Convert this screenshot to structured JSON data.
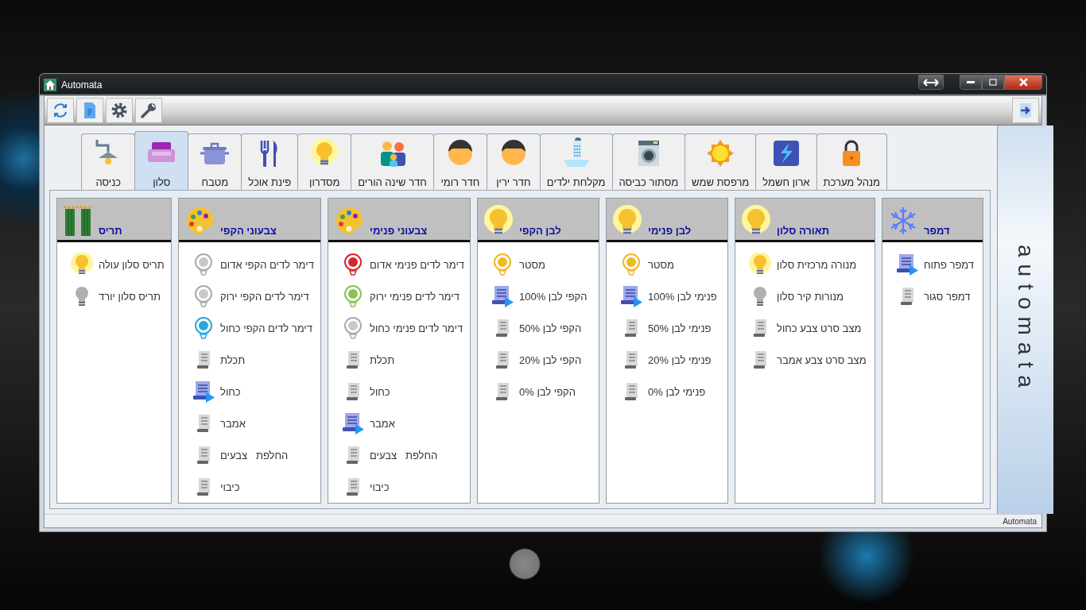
{
  "window": {
    "title": "Automata"
  },
  "tabs": [
    {
      "label": "מנהל מערכת",
      "kind": "lock",
      "selected": false
    },
    {
      "label": "ארון חשמל",
      "kind": "lightning",
      "selected": false
    },
    {
      "label": "מרפסת שמש",
      "kind": "sun",
      "selected": false
    },
    {
      "label": "מסתור כביסה",
      "kind": "washer",
      "selected": false
    },
    {
      "label": "מקלחת ילדים",
      "kind": "shower",
      "selected": false
    },
    {
      "label": "חדר ירין",
      "kind": "person",
      "selected": false
    },
    {
      "label": "חדר רומי",
      "kind": "person",
      "selected": false
    },
    {
      "label": "חדר שינה הורים",
      "kind": "family",
      "selected": false
    },
    {
      "label": "מסדרון",
      "kind": "bulb",
      "selected": false
    },
    {
      "label": "פינת אוכל",
      "kind": "cutlery",
      "selected": false
    },
    {
      "label": "מטבח",
      "kind": "pot",
      "selected": false
    },
    {
      "label": "סלון",
      "kind": "sofa",
      "selected": true
    },
    {
      "label": "כניסה",
      "kind": "lamp",
      "selected": false
    }
  ],
  "panels": [
    {
      "title": "דמפר",
      "kind": "snowflake",
      "items": [
        {
          "label": "דמפר פתוח",
          "kind": "scene",
          "on": true
        },
        {
          "label": "דמפר סגור",
          "kind": "scene",
          "on": false
        }
      ]
    },
    {
      "title": "תאורה סלון",
      "kind": "bulb",
      "items": [
        {
          "label": "מנורה מרכזית סלון",
          "kind": "lamp",
          "on": true
        },
        {
          "label": "מנורות קיר סלון",
          "kind": "lamp",
          "on": false
        },
        {
          "label": "מצב סרט צבע כחול",
          "kind": "scene",
          "on": false
        },
        {
          "label": "מצב סרט צבע אמבר",
          "kind": "scene",
          "on": false
        }
      ]
    },
    {
      "title": "לבן פנימי",
      "kind": "bulb",
      "items": [
        {
          "label": "מסטר",
          "kind": "led",
          "on": true,
          "color": "#f2b824"
        },
        {
          "label": "פנימי לבן 100%",
          "kind": "scene",
          "on": true
        },
        {
          "label": "פנימי לבן 50%",
          "kind": "scene",
          "on": false
        },
        {
          "label": "פנימי לבן 20%",
          "kind": "scene",
          "on": false
        },
        {
          "label": "פנימי לבן 0%",
          "kind": "scene",
          "on": false
        }
      ]
    },
    {
      "title": "לבן הקפי",
      "kind": "bulb",
      "items": [
        {
          "label": "מסטר",
          "kind": "led",
          "on": true,
          "color": "#f2b824"
        },
        {
          "label": "הקפי לבן 100%",
          "kind": "scene",
          "on": true
        },
        {
          "label": "הקפי לבן 50%",
          "kind": "scene",
          "on": false
        },
        {
          "label": "הקפי לבן 20%",
          "kind": "scene",
          "on": false
        },
        {
          "label": "הקפי לבן 0%",
          "kind": "scene",
          "on": false
        }
      ]
    },
    {
      "title": "צבעוני פנימי",
      "kind": "palette",
      "items": [
        {
          "label": "דימר לדים פנימי אדום",
          "kind": "led",
          "on": true,
          "color": "#d7262b"
        },
        {
          "label": "דימר לדים פנימי ירוק",
          "kind": "led",
          "on": true,
          "color": "#8cc350"
        },
        {
          "label": "דימר לדים פנימי כחול",
          "kind": "led",
          "on": false
        },
        {
          "label": "תכלת",
          "kind": "scene",
          "on": false
        },
        {
          "label": "כחול",
          "kind": "scene",
          "on": false
        },
        {
          "label": "אמבר",
          "kind": "scene",
          "on": true
        },
        {
          "label": "החלפת   צבעים",
          "kind": "scene",
          "on": false
        },
        {
          "label": "כיבוי",
          "kind": "scene",
          "on": false
        }
      ]
    },
    {
      "title": "צבעוני הקפי",
      "kind": "palette",
      "items": [
        {
          "label": "דימר לדים הקפי אדום",
          "kind": "led",
          "on": false
        },
        {
          "label": "דימר לדים הקפי ירוק",
          "kind": "led",
          "on": false
        },
        {
          "label": "דימר לדים הקפי כחול",
          "kind": "led",
          "on": true,
          "color": "#2aa7dc"
        },
        {
          "label": "תכלת",
          "kind": "scene",
          "on": false
        },
        {
          "label": "כחול",
          "kind": "scene",
          "on": true
        },
        {
          "label": "אמבר",
          "kind": "scene",
          "on": false
        },
        {
          "label": "החלפת   צבעים",
          "kind": "scene",
          "on": false
        },
        {
          "label": "כיבוי",
          "kind": "scene",
          "on": false
        }
      ]
    },
    {
      "title": "תריס",
      "kind": "curtain",
      "items": [
        {
          "label": "תריס סלון עולה",
          "kind": "lamp",
          "on": true
        },
        {
          "label": "תריס סלון יורד",
          "kind": "lamp",
          "on": false
        }
      ]
    }
  ],
  "side_panel": {
    "label": "automata"
  },
  "status_bar": {
    "text": "Automata"
  }
}
